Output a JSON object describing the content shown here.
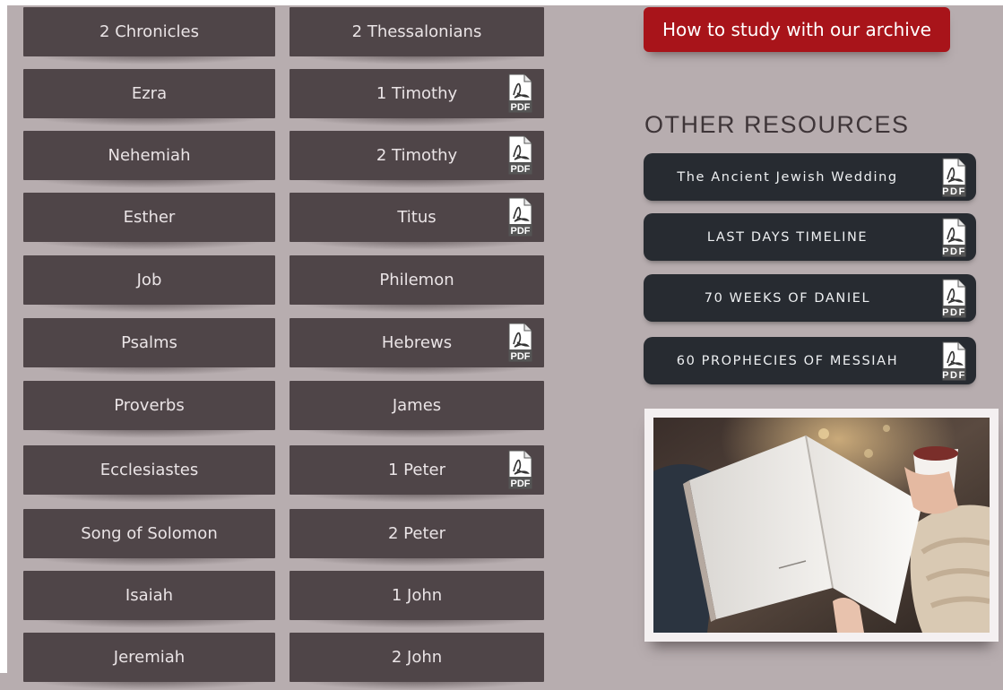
{
  "old_testament": [
    {
      "label": "2 Chronicles",
      "pdf": false
    },
    {
      "label": "Ezra",
      "pdf": false
    },
    {
      "label": "Nehemiah",
      "pdf": false
    },
    {
      "label": "Esther",
      "pdf": false
    },
    {
      "label": "Job",
      "pdf": false
    },
    {
      "label": "Psalms",
      "pdf": false
    },
    {
      "label": "Proverbs",
      "pdf": false
    },
    {
      "label": "Ecclesiastes",
      "pdf": false
    },
    {
      "label": "Song of Solomon",
      "pdf": false
    },
    {
      "label": "Isaiah",
      "pdf": false
    },
    {
      "label": "Jeremiah",
      "pdf": false
    }
  ],
  "new_testament": [
    {
      "label": "2 Thessalonians",
      "pdf": false
    },
    {
      "label": "1 Timothy",
      "pdf": true
    },
    {
      "label": "2 Timothy",
      "pdf": true
    },
    {
      "label": "Titus",
      "pdf": true
    },
    {
      "label": "Philemon",
      "pdf": false
    },
    {
      "label": "Hebrews",
      "pdf": true
    },
    {
      "label": "James",
      "pdf": false
    },
    {
      "label": "1 Peter",
      "pdf": true
    },
    {
      "label": "2 Peter",
      "pdf": false
    },
    {
      "label": "1 John",
      "pdf": false
    },
    {
      "label": "2 John",
      "pdf": false
    }
  ],
  "sidebar": {
    "study_button": "How to study with our archive",
    "section_title": "OTHER RESOURCES",
    "resources": [
      {
        "label": "The Ancient Jewish Wedding",
        "pdf": true
      },
      {
        "label": "LAST DAYS TIMELINE",
        "pdf": true
      },
      {
        "label": "70 WEEKS OF DANIEL",
        "pdf": true
      },
      {
        "label": "60 PROPHECIES OF MESSIAH",
        "pdf": true
      }
    ],
    "photo_icon": "open-book-with-coffee-photo"
  },
  "icons": {
    "pdf": "pdf-file-icon",
    "pdf_text": "PDF"
  },
  "colors": {
    "background": "#b7adaf",
    "book_button": "#4f4548",
    "study_button": "#a8141a",
    "resource_button": "#272b31"
  }
}
